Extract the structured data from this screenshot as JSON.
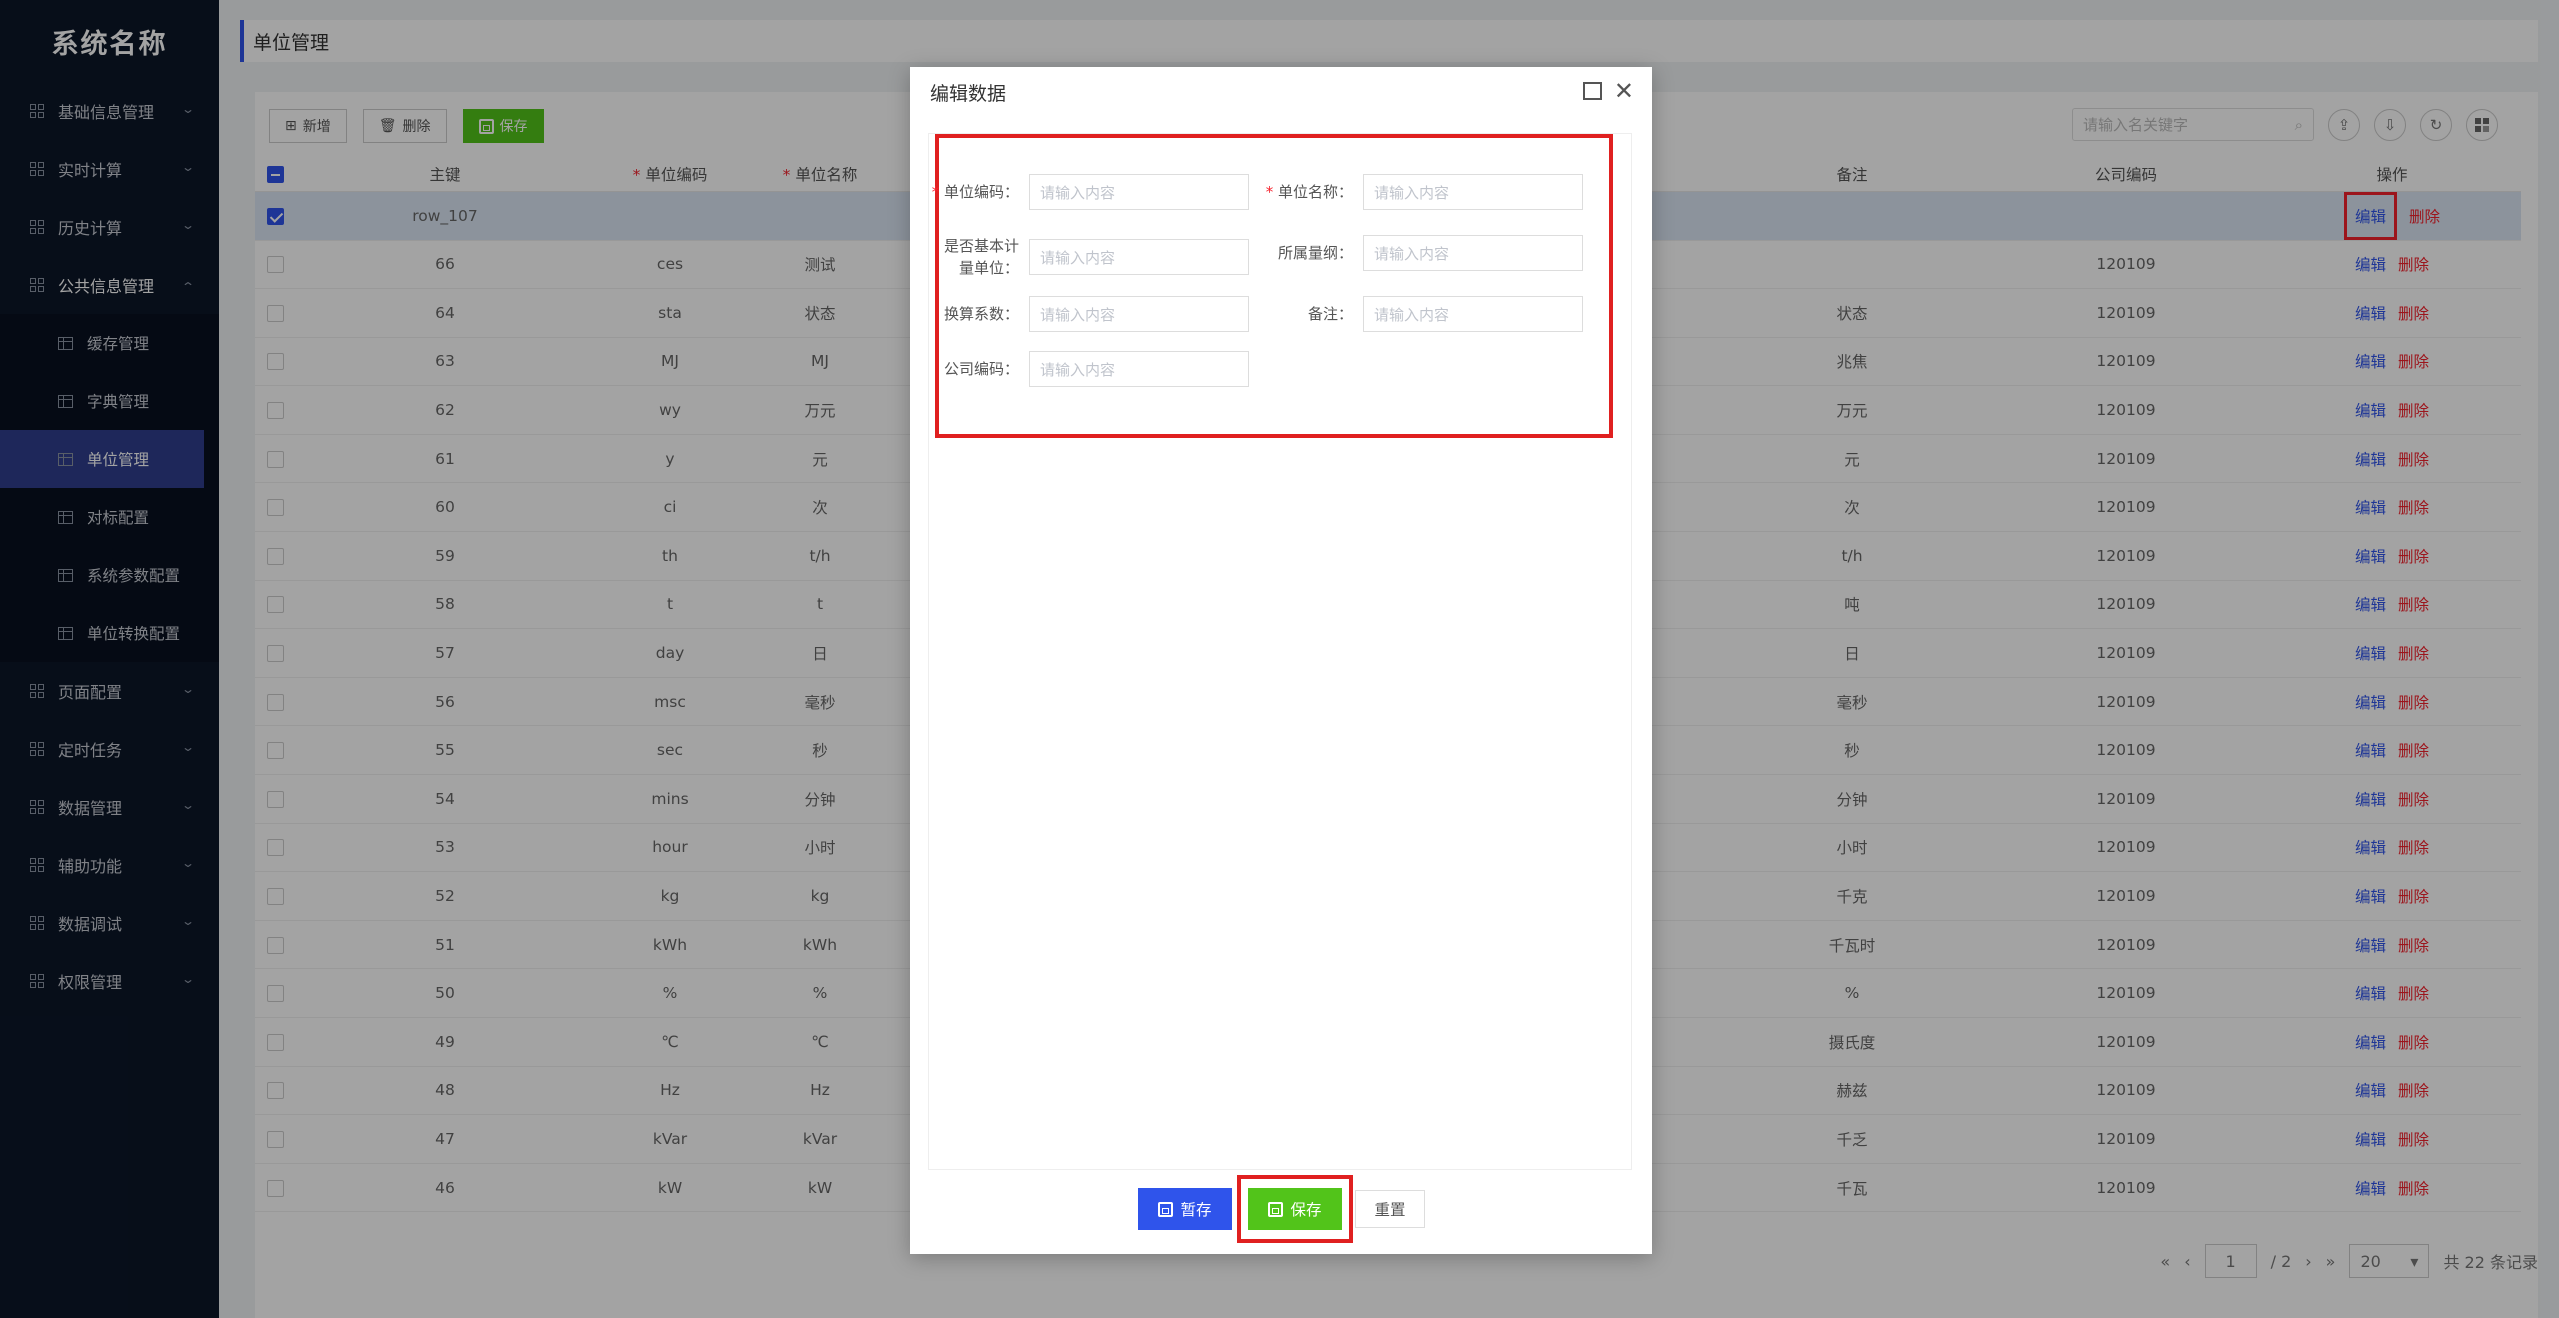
{
  "sidebar": {
    "logo": "系统名称",
    "menu": [
      {
        "label": "基础信息管理",
        "chev": "⌄"
      },
      {
        "label": "实时计算",
        "chev": "⌄"
      },
      {
        "label": "历史计算",
        "chev": "⌄"
      },
      {
        "label": "公共信息管理",
        "chev": "⌃"
      }
    ],
    "submenu": [
      "缓存管理",
      "字典管理",
      "单位管理",
      "对标配置",
      "系统参数配置",
      "单位转换配置"
    ],
    "menu2": [
      "页面配置",
      "定时任务",
      "数据管理",
      "辅助功能",
      "数据调试",
      "权限管理"
    ]
  },
  "page": {
    "title": "单位管理"
  },
  "toolbar": {
    "add": "新增",
    "delete": "删除",
    "save": "保存",
    "search_placeholder": "请输入名关键字"
  },
  "table": {
    "headers": {
      "key": "主键",
      "code": "单位编码",
      "name": "单位名称",
      "remark": "备注",
      "company": "公司编码",
      "op": "操作"
    },
    "edit_label": "编辑",
    "delete_label": "删除",
    "rows": [
      {
        "key": "row_107",
        "code": "",
        "name": "",
        "remark": "",
        "company": ""
      },
      {
        "key": "66",
        "code": "ces",
        "name": "测试",
        "remark": "",
        "company": "120109"
      },
      {
        "key": "64",
        "code": "sta",
        "name": "状态",
        "remark": "状态",
        "company": "120109"
      },
      {
        "key": "63",
        "code": "MJ",
        "name": "MJ",
        "remark": "兆焦",
        "company": "120109"
      },
      {
        "key": "62",
        "code": "wy",
        "name": "万元",
        "remark": "万元",
        "company": "120109"
      },
      {
        "key": "61",
        "code": "y",
        "name": "元",
        "remark": "元",
        "company": "120109"
      },
      {
        "key": "60",
        "code": "ci",
        "name": "次",
        "remark": "次",
        "company": "120109"
      },
      {
        "key": "59",
        "code": "th",
        "name": "t/h",
        "remark": "t/h",
        "company": "120109"
      },
      {
        "key": "58",
        "code": "t",
        "name": "t",
        "remark": "吨",
        "company": "120109"
      },
      {
        "key": "57",
        "code": "day",
        "name": "日",
        "remark": "日",
        "company": "120109"
      },
      {
        "key": "56",
        "code": "msc",
        "name": "毫秒",
        "remark": "毫秒",
        "company": "120109"
      },
      {
        "key": "55",
        "code": "sec",
        "name": "秒",
        "remark": "秒",
        "company": "120109"
      },
      {
        "key": "54",
        "code": "mins",
        "name": "分钟",
        "remark": "分钟",
        "company": "120109"
      },
      {
        "key": "53",
        "code": "hour",
        "name": "小时",
        "remark": "小时",
        "company": "120109"
      },
      {
        "key": "52",
        "code": "kg",
        "name": "kg",
        "remark": "千克",
        "company": "120109"
      },
      {
        "key": "51",
        "code": "kWh",
        "name": "kWh",
        "remark": "千瓦时",
        "company": "120109"
      },
      {
        "key": "50",
        "code": "%",
        "name": "%",
        "remark": "%",
        "company": "120109"
      },
      {
        "key": "49",
        "code": "℃",
        "name": "℃",
        "remark": "摄氏度",
        "company": "120109"
      },
      {
        "key": "48",
        "code": "Hz",
        "name": "Hz",
        "remark": "赫兹",
        "company": "120109"
      },
      {
        "key": "47",
        "code": "kVar",
        "name": "kVar",
        "remark": "千乏",
        "company": "120109"
      },
      {
        "key": "46",
        "code": "kW",
        "name": "kW",
        "remark": "千瓦",
        "company": "120109"
      }
    ]
  },
  "pager": {
    "page": "1",
    "total_pages": "/ 2",
    "size": "20",
    "total": "共 22 条记录",
    "first": "«",
    "prev": "‹",
    "next": "›",
    "last": "»"
  },
  "modal": {
    "title": "编辑数据",
    "placeholder": "请输入内容",
    "fields": {
      "unit_code": "单位编码：",
      "unit_name": "单位名称：",
      "is_base_1": "是否基本计",
      "is_base_2": "量单位：",
      "dimension": "所属量纲：",
      "factor": "换算系数：",
      "remark": "备注：",
      "company": "公司编码："
    },
    "buttons": {
      "temp_save": "暂存",
      "save": "保存",
      "reset": "重置"
    }
  },
  "colors": {
    "sidebar_bg": "#0b1628",
    "accent": "#2f54eb",
    "save_green": "#52c41a",
    "danger": "#f5222d"
  }
}
